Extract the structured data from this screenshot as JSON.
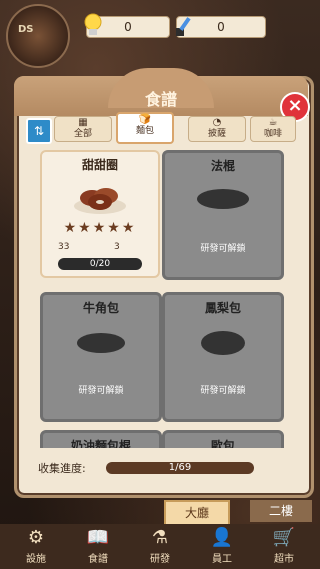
{
  "top": {
    "logo_text": "DS",
    "gold": "0",
    "gems": "0"
  },
  "dialog": {
    "title": "食譜",
    "close_icon": "×",
    "sort_icon": "⇅",
    "tabs": [
      {
        "label": "全部",
        "icon": "▦"
      },
      {
        "label": "麵包",
        "icon": "🍞"
      },
      {
        "label": "披薩",
        "icon": "◔"
      },
      {
        "label": "咖啡",
        "icon": "☕"
      }
    ],
    "cards": [
      {
        "name": "甜甜圈",
        "stars": "★★★★★",
        "stat1": "33",
        "stat2": "3",
        "progress": "0/20",
        "progress_fraction": 0.0
      },
      {
        "name": "法棍",
        "locked": "研發可解鎖"
      },
      {
        "name": "牛角包",
        "locked": "研發可解鎖"
      },
      {
        "name": "鳳梨包",
        "locked": "研發可解鎖"
      },
      {
        "name": "奶油麵包棍"
      },
      {
        "name": "歐包"
      }
    ],
    "collection_label": "收集進度:",
    "collection_progress": "1/69",
    "collection_fraction": 0.0145
  },
  "floors": [
    "大廳",
    "二樓"
  ],
  "nav": [
    {
      "label": "設施",
      "icon": "⚙"
    },
    {
      "label": "食譜",
      "icon": "📖"
    },
    {
      "label": "研發",
      "icon": "⚗"
    },
    {
      "label": "員工",
      "icon": "👤"
    },
    {
      "label": "超市",
      "icon": "🛒"
    }
  ]
}
